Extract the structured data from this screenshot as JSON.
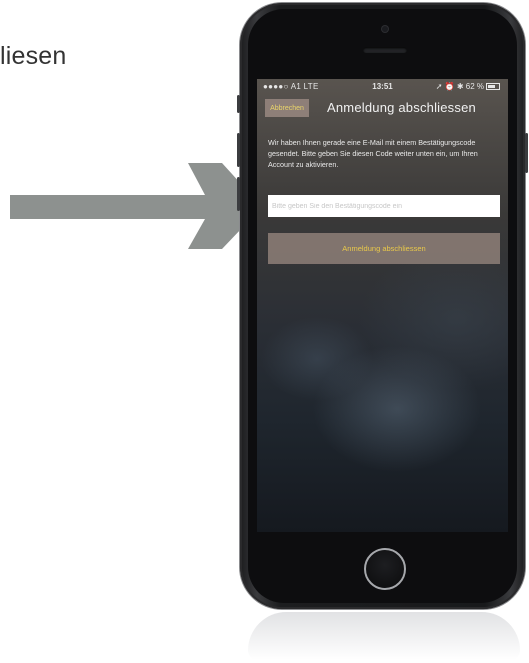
{
  "background_text": "liesen",
  "phone": {
    "status_bar": {
      "carrier": "●●●●○ A1  LTE",
      "time": "13:51",
      "indicators": "➚ ⏰ ✱ 62 %"
    },
    "nav": {
      "cancel_label": "Abbrechen",
      "title": "Anmeldung abschliessen"
    },
    "info_text": "Wir haben Ihnen gerade eine E-Mail mit einem Bestätigungscode gesendet. Bitte geben Sie diesen Code weiter unten ein, um Ihren Account zu aktivieren.",
    "code_input": {
      "value": "",
      "placeholder": "Bitte geben Sie den Bestätigungscode ein"
    },
    "submit_label": "Anmeldung abschliessen"
  },
  "colors": {
    "arrow": "#8d918f",
    "button_bg": "#8e7f78",
    "button_text": "#e9c94a"
  },
  "icons": [
    "arrow-right-icon",
    "battery-icon",
    "home-button-icon"
  ]
}
